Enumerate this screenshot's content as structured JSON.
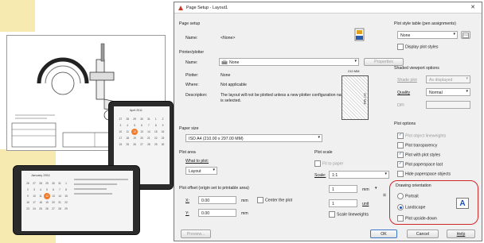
{
  "window": {
    "title": "Page Setup - Layout1"
  },
  "page_setup": {
    "group": "Page setup",
    "name_label": "Name:",
    "name_value": "<None>"
  },
  "printer": {
    "group": "Printer/plotter",
    "name_label": "Name:",
    "name_value": "None",
    "properties_button": "Properties",
    "plotter_label": "Plotter:",
    "plotter_value": "None",
    "where_label": "Where:",
    "where_value": "Not applicable",
    "description_label": "Description:",
    "description_value": "The layout will not be plotted unless a new plotter configuration name is selected.",
    "preview_width": "210 MM",
    "preview_height": "297 MM"
  },
  "paper_size": {
    "group": "Paper size",
    "value": "ISO A4 (210.00 x 297.00 MM)"
  },
  "plot_area": {
    "group": "Plot area",
    "what_label": "What to plot:",
    "what_value": "Layout"
  },
  "plot_offset": {
    "group": "Plot offset (origin set to printable area)",
    "x_label": "X:",
    "x_value": "0.00",
    "x_unit": "mm",
    "y_label": "Y:",
    "y_value": "0.00",
    "y_unit": "mm",
    "center_label": "Center the plot"
  },
  "plot_scale": {
    "group": "Plot scale",
    "fit_label": "Fit to paper",
    "scale_label": "Scale:",
    "scale_value": "1:1",
    "num_value": "1",
    "num_unit": "mm",
    "unit_value": "1",
    "unit_label": "unit",
    "lineweights_label": "Scale lineweights"
  },
  "plot_style": {
    "group": "Plot style table (pen assignments)",
    "value": "None",
    "display_label": "Display plot styles"
  },
  "shaded": {
    "group": "Shaded viewport options",
    "shade_label": "Shade plot",
    "shade_value": "As displayed",
    "quality_label": "Quality",
    "quality_value": "Normal",
    "dpi_label": "DPI"
  },
  "plot_options": {
    "group": "Plot options",
    "items": [
      {
        "label": "Plot object lineweights",
        "checked": true,
        "disabled": true
      },
      {
        "label": "Plot transparency",
        "checked": false,
        "disabled": false
      },
      {
        "label": "Plot with plot styles",
        "checked": true,
        "disabled": false
      },
      {
        "label": "Plot paperspace last",
        "checked": true,
        "disabled": false
      },
      {
        "label": "Hide paperspace objects",
        "checked": false,
        "disabled": false
      }
    ]
  },
  "orientation": {
    "group": "Drawing orientation",
    "portrait": "Portrait",
    "landscape": "Landscape",
    "upside": "Plot upside-down",
    "selected": "Landscape"
  },
  "footer": {
    "preview": "Preview...",
    "ok": "OK",
    "cancel": "Cancel",
    "help": "Help"
  },
  "calendar": {
    "month": "January 2011",
    "month_small": "April 2011"
  },
  "colors": {
    "accent_red": "#d3262a",
    "selection_orange": "#f07b2a",
    "collage_yellow": "#f7eab0"
  }
}
